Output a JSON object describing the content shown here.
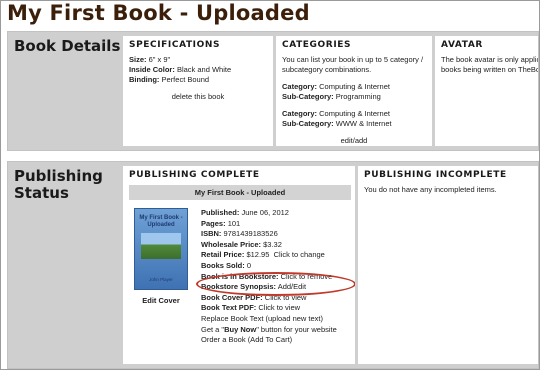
{
  "page": {
    "title": "My First Book - Uploaded"
  },
  "book_details": {
    "label": "Book Details",
    "specifications": {
      "header": "SPECIFICATIONS",
      "size_label": "Size:",
      "size_value": "6\" x 9\"",
      "inside_color_label": "Inside Color:",
      "inside_color_value": "Black and White",
      "binding_label": "Binding:",
      "binding_value": "Perfect Bound",
      "delete_link": "delete this book"
    },
    "categories": {
      "header": "CATEGORIES",
      "intro_line1": "You can list your book in up to 5 category /",
      "intro_line2": "subcategory combinations.",
      "entries": [
        {
          "category_label": "Category:",
          "category": "Computing & Internet",
          "sub_label": "Sub-Category:",
          "sub": "Programming"
        },
        {
          "category_label": "Category:",
          "category": "Computing & Internet",
          "sub_label": "Sub-Category:",
          "sub": "WWW & Internet"
        }
      ],
      "edit_link": "edit/add"
    },
    "avatar": {
      "header": "AVATAR",
      "line1": "The book avatar is only applica",
      "line2": "books being written on TheBoo"
    }
  },
  "publishing_status": {
    "label_line1": "Publishing",
    "label_line2": "Status",
    "complete": {
      "header": "PUBLISHING COMPLETE",
      "banner": "My First Book - Uploaded",
      "cover": {
        "title_line1": "My First Book -",
        "title_line2": "Uploaded",
        "author": "John Player"
      },
      "edit_cover": "Edit Cover",
      "published_label": "Published:",
      "published_value": "June 06, 2012",
      "pages_label": "Pages:",
      "pages_value": "101",
      "isbn_label": "ISBN:",
      "isbn_value": "9781439183526",
      "wholesale_label": "Wholesale Price:",
      "wholesale_value": "$3.32",
      "retail_label": "Retail Price:",
      "retail_value": "$12.95",
      "retail_action": "Click to change",
      "sold_label": "Books Sold:",
      "sold_value": "0",
      "bookstore_label": "Book is in Bookstore:",
      "bookstore_action": "Click to remove",
      "synopsis_label": "Bookstore Synopsis:",
      "synopsis_action": "Add/Edit",
      "cover_pdf_label": "Book Cover PDF:",
      "cover_pdf_action": "Click to view",
      "text_pdf_label": "Book Text PDF:",
      "text_pdf_action": "Click to view",
      "replace_text": "Replace Book Text (upload new text)",
      "buy_now_prefix": "Get a \"",
      "buy_now_bold": "Buy Now",
      "buy_now_suffix": "\" button for your website",
      "order_book": "Order a Book (Add To Cart)"
    },
    "incomplete": {
      "header": "PUBLISHING INCOMPLETE",
      "message": "You do not have any incompleted items."
    }
  },
  "colors": {
    "annotation": "#c0392b",
    "title": "#3b1f0a",
    "section_bg": "#cfcfcf"
  }
}
